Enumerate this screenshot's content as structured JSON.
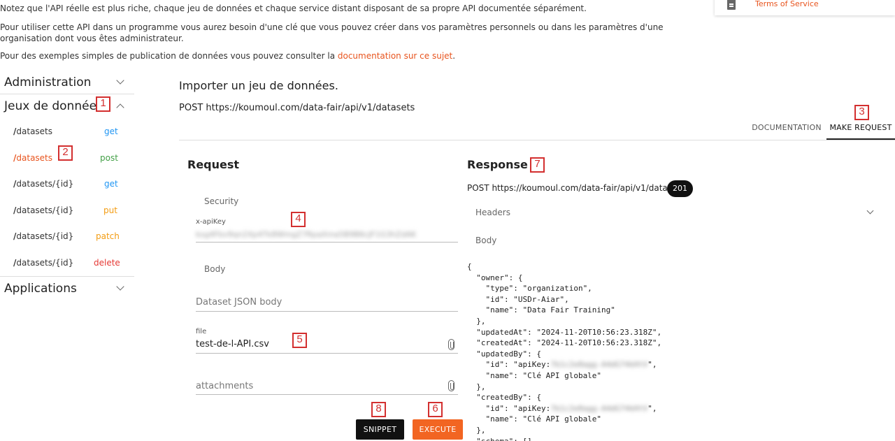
{
  "intro": {
    "line1": "Notez que l'API réelle est plus riche, chaque jeu de données et chaque service distant disposant de sa propre API documentée séparément.",
    "line2": "Pour utiliser cette API dans un programme vous aurez besoin d'une clé que vous pouvez créer dans vos paramètres personnels ou dans les paramètres d'une organisation dont vous êtes administrateur.",
    "line3_prefix": "Pour des exemples simples de publication de données vous pouvez consulter la ",
    "line3_link": "documentation sur ce sujet",
    "line3_suffix": "."
  },
  "tos": {
    "label": "Terms of Service",
    "icon": "document-icon"
  },
  "sidebar": {
    "groups": [
      {
        "label": "Administration",
        "expanded": false
      },
      {
        "label": "Jeux de données",
        "expanded": true
      },
      {
        "label": "Applications",
        "expanded": false
      }
    ],
    "endpoints": [
      {
        "prefix": "/",
        "path": "datasets",
        "method": "get",
        "active": false
      },
      {
        "prefix": "/",
        "path": "datasets",
        "method": "post",
        "active": true
      },
      {
        "prefix": "/",
        "path": "datasets/{id}",
        "method": "get",
        "active": false
      },
      {
        "prefix": "/",
        "path": "datasets/{id}",
        "method": "put",
        "active": false
      },
      {
        "prefix": "/",
        "path": "datasets/{id}",
        "method": "patch",
        "active": false
      },
      {
        "prefix": "/",
        "path": "datasets/{id}",
        "method": "delete",
        "active": false
      }
    ]
  },
  "main": {
    "title": "Importer un jeu de données.",
    "endpoint": "POST https://koumoul.com/data-fair/api/v1/datasets",
    "tabs": [
      "DOCUMENTATION",
      "MAKE REQUEST"
    ],
    "active_tab": "MAKE REQUEST"
  },
  "request": {
    "title": "Request",
    "security_label": "Security",
    "apikey_label": "x-apiKey",
    "apikey_value": "ksg4Fbv9qn2Xp4Tk8WmgZ7RpaXma5B9B6cJF1G3hZdAK",
    "body_label": "Body",
    "json_body_placeholder": "Dataset JSON body",
    "file_label": "file",
    "file_value": "test-de-l-API.csv",
    "attachments_placeholder": "attachments",
    "snippet_label": "SNIPPET",
    "execute_label": "EXECUTE"
  },
  "response": {
    "title": "Response",
    "endpoint": "POST https://koumoul.com/data-fair/api/v1/datasets",
    "status": "201",
    "headers_label": "Headers",
    "body_label": "Body",
    "json_lines": [
      "{",
      "  \"owner\": {",
      "    \"type\": \"organization\",",
      "    \"id\": \"USDr-Aiar\",",
      "    \"name\": \"Data Fair Training\"",
      "  },",
      "  \"updatedAt\": \"2024-11-20T10:56:23.318Z\",",
      "  \"createdAt\": \"2024-11-20T10:56:23.318Z\",",
      "  \"updatedBy\": {",
      "    \"id\": \"apiKey:",
      "    \"name\": \"Clé API globale\"",
      "  },",
      "  \"createdBy\": {",
      "    \"id\": \"apiKey:",
      "    \"name\": \"Clé API globale\"",
      "  },",
      "  \"schema\": [],"
    ],
    "blurred_key": "7b1c2e8agg-A4dG74kHtV",
    "blurred_key_suffix": "\","
  },
  "annotations": [
    "1",
    "2",
    "3",
    "4",
    "5",
    "6",
    "7",
    "8"
  ]
}
